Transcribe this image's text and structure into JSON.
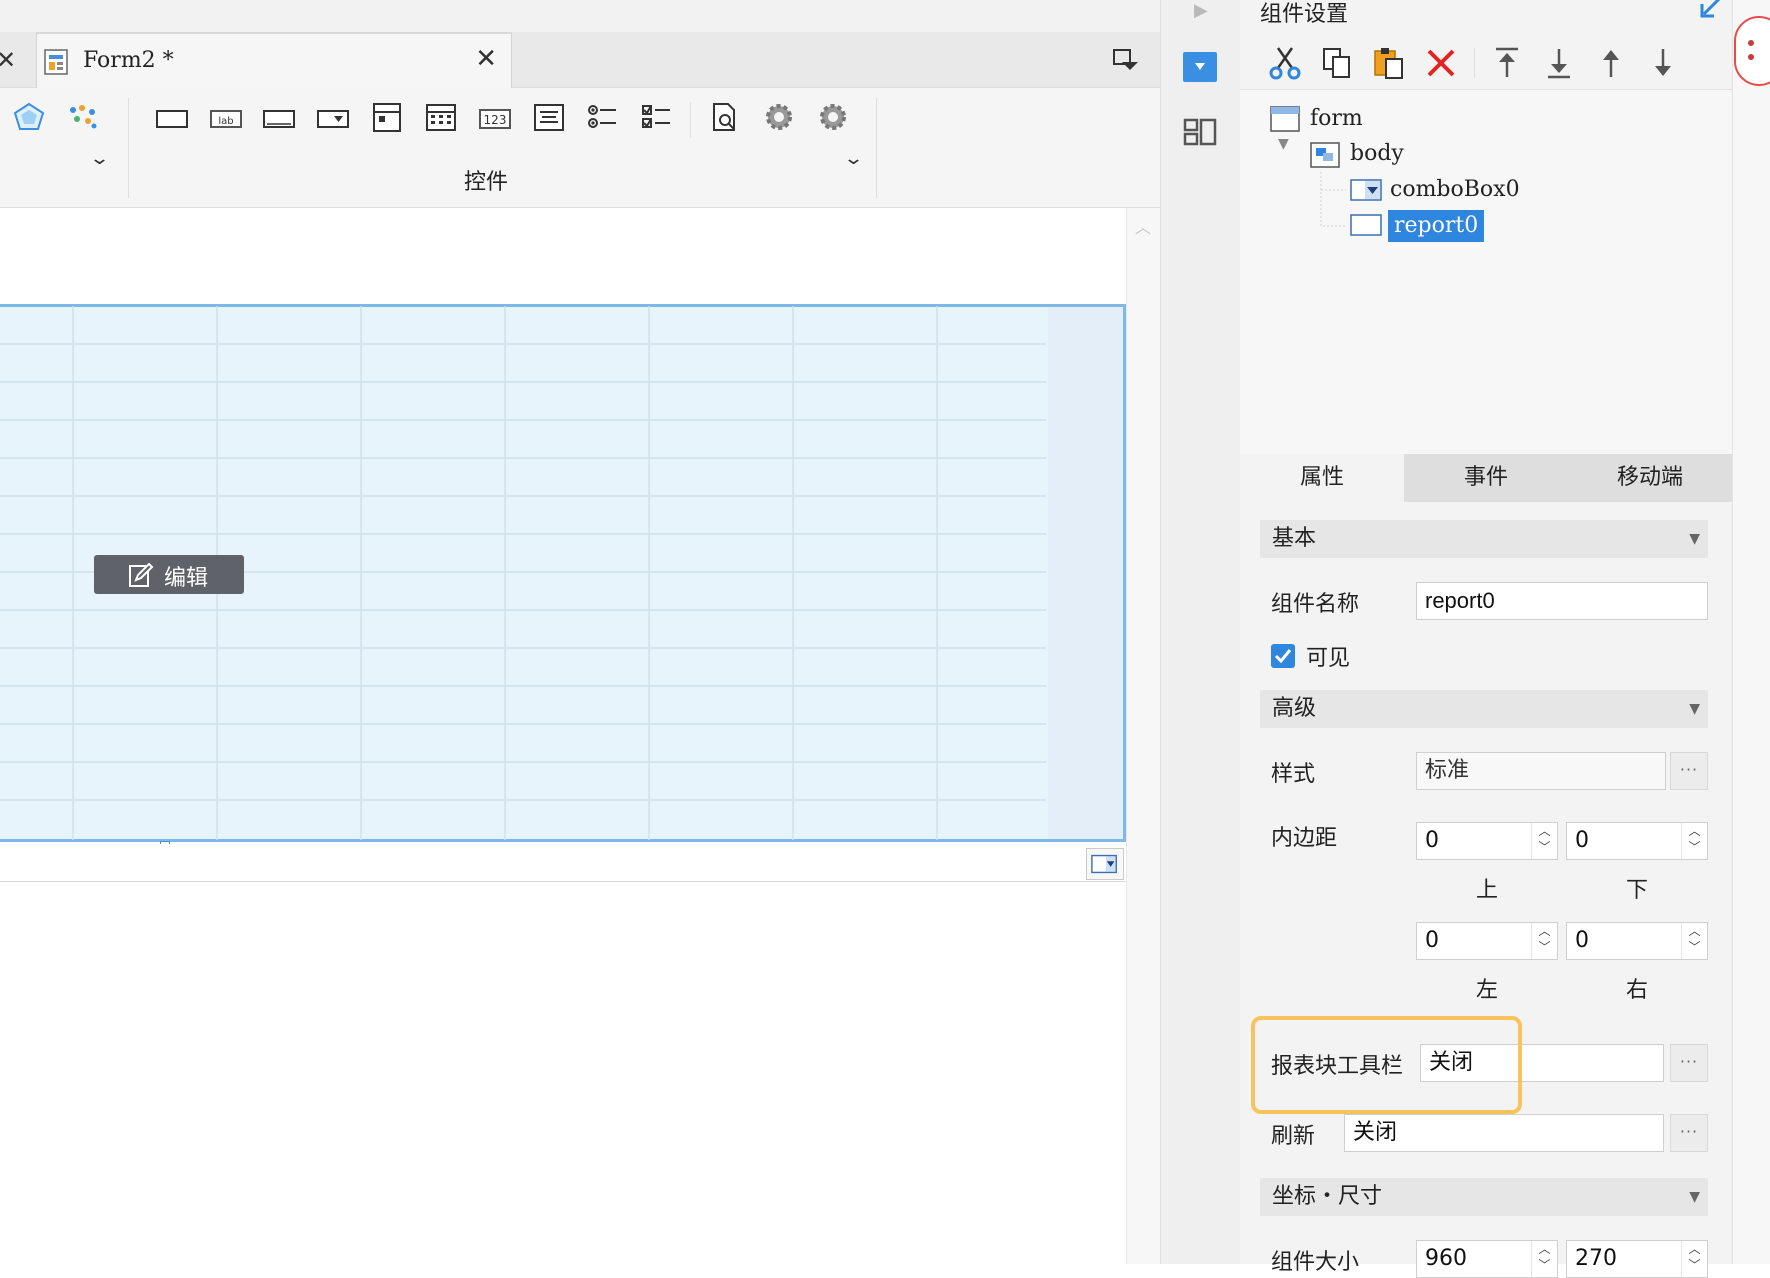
{
  "editor": {
    "tab_title": "Form2 *",
    "toolbar_group_label": "控件",
    "edit_button_label": "编辑"
  },
  "panel": {
    "title": "组件设置",
    "tree": {
      "root": "form",
      "body": "body",
      "children": [
        "comboBox0",
        "report0"
      ],
      "selected": "report0"
    },
    "tabs": [
      "属性",
      "事件",
      "移动端"
    ],
    "active_tab": "属性",
    "sections": {
      "basic": "基本",
      "advanced": "高级",
      "position_size": "坐标・尺寸"
    },
    "basic": {
      "name_label": "组件名称",
      "name_value": "report0",
      "visible_label": "可见",
      "visible_checked": true
    },
    "advanced": {
      "style_label": "样式",
      "style_value": "标准",
      "padding_label": "内边距",
      "padding": {
        "top": "0",
        "bottom": "0",
        "left": "0",
        "right": "0"
      },
      "padding_sublabels": {
        "top": "上",
        "bottom": "下",
        "left": "左",
        "right": "右"
      },
      "toolbar_label": "报表块工具栏",
      "toolbar_value": "关闭",
      "refresh_label": "刷新",
      "refresh_value": "关闭"
    },
    "position_size": {
      "size_label": "组件大小",
      "width": "960",
      "height": "270"
    }
  },
  "colors": {
    "accent": "#2e86de",
    "highlight": "#f7c35a",
    "report_bg": "#e8f4fb",
    "delete_red": "#e02424"
  }
}
